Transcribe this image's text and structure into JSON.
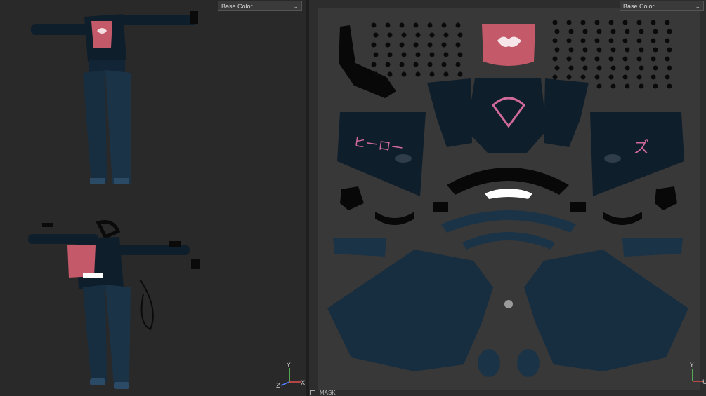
{
  "viewport_3d": {
    "channel_select": "Base Color",
    "axis_labels": {
      "x": "X",
      "y": "Y",
      "z": "Z"
    }
  },
  "viewport_2d": {
    "channel_select": "Base Color",
    "axis_labels": {
      "y": "Y",
      "u": "U"
    }
  },
  "bottom_bar": {
    "mask_label": "MASK"
  },
  "uv_texts": {
    "sleeve_left_text": "ヒーロー",
    "sleeve_right_text": "ズ"
  },
  "colors": {
    "background": "#2a2a2a",
    "fabric_dark": "#0f1e2b",
    "denim": "#1b3347",
    "pink_patch": "#c4596a",
    "accent_pink": "#d06a9a",
    "axis_x": "#e05050",
    "axis_y": "#60d060",
    "axis_z": "#5080ff"
  }
}
